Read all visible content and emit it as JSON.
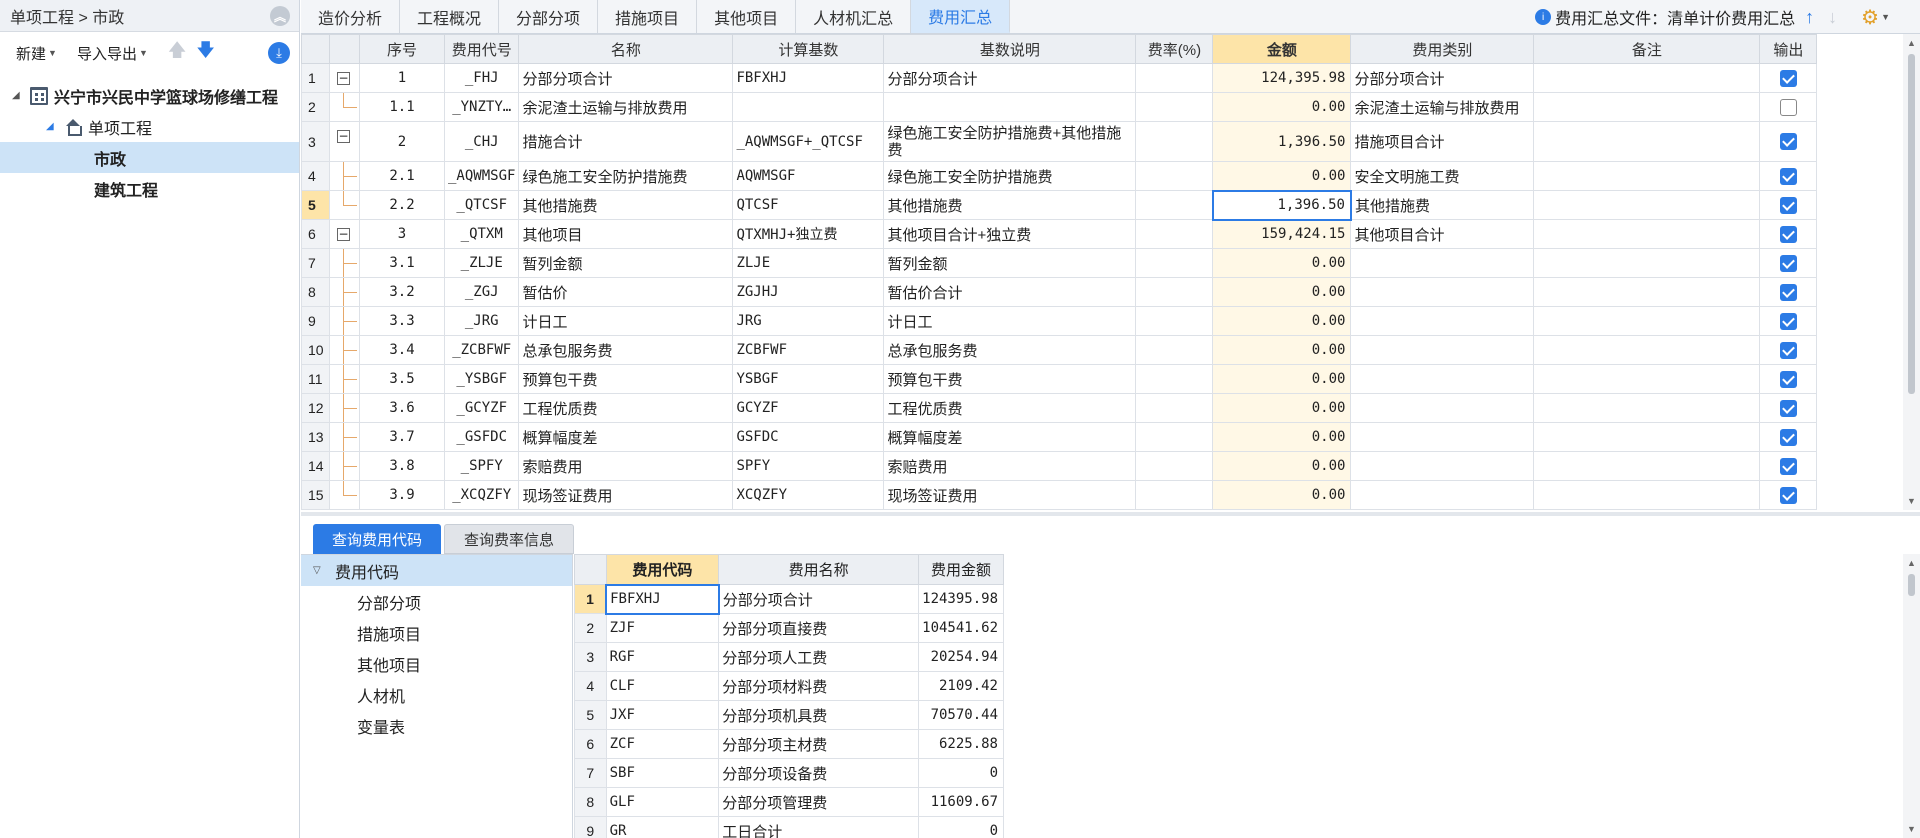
{
  "left": {
    "breadcrumb": "单项工程 > 市政",
    "toolbar": {
      "new_label": "新建",
      "import_export_label": "导入导出"
    },
    "tree": [
      {
        "label": "兴宁市兴民中学篮球场修缮工程",
        "icon": "building-icon"
      },
      {
        "label": "单项工程",
        "icon": "home-icon"
      },
      {
        "label": "市政",
        "selected": true
      },
      {
        "label": "建筑工程"
      }
    ]
  },
  "tabs": [
    {
      "label": "造价分析"
    },
    {
      "label": "工程概况"
    },
    {
      "label": "分部分项"
    },
    {
      "label": "措施项目"
    },
    {
      "label": "其他项目"
    },
    {
      "label": "人材机汇总"
    },
    {
      "label": "费用汇总",
      "active": true
    }
  ],
  "file_info": {
    "label": "费用汇总文件：清单计价费用汇总"
  },
  "main_table": {
    "headers": [
      "序号",
      "费用代号",
      "名称",
      "计算基数",
      "基数说明",
      "费率(%)",
      "金额",
      "费用类别",
      "备注",
      "输出"
    ],
    "rows": [
      {
        "num": "1",
        "seq": "1",
        "code": "_FHJ",
        "name": "分部分项合计",
        "base": "FBFXHJ",
        "desc": "分部分项合计",
        "rate": "",
        "amount": "124,395.98",
        "category": "分部分项合计",
        "note": "",
        "output": true,
        "level": 0
      },
      {
        "num": "2",
        "seq": "1.1",
        "code": "_YNZTY…",
        "name": "余泥渣土运输与排放费用",
        "base": "",
        "desc": "",
        "rate": "",
        "amount": "0.00",
        "category": "余泥渣土运输与排放费用",
        "note": "",
        "output": false,
        "level": 1
      },
      {
        "num": "3",
        "seq": "2",
        "code": "_CHJ",
        "name": "措施合计",
        "base": "_AQWMSGF+_QTCSF",
        "desc": "绿色施工安全防护措施费+其他措施费",
        "rate": "",
        "amount": "1,396.50",
        "category": "措施项目合计",
        "note": "",
        "output": true,
        "level": 0
      },
      {
        "num": "4",
        "seq": "2.1",
        "code": "_AQWMSGF",
        "name": "绿色施工安全防护措施费",
        "base": "AQWMSGF",
        "desc": "绿色施工安全防护措施费",
        "rate": "",
        "amount": "0.00",
        "category": "安全文明施工费",
        "note": "",
        "output": true,
        "level": 1
      },
      {
        "num": "5",
        "seq": "2.2",
        "code": "_QTCSF",
        "name": "其他措施费",
        "base": "QTCSF",
        "desc": "其他措施费",
        "rate": "",
        "amount": "1,396.50",
        "category": "其他措施费",
        "note": "",
        "output": true,
        "level": 1,
        "selected": true
      },
      {
        "num": "6",
        "seq": "3",
        "code": "_QTXM",
        "name": "其他项目",
        "base": "QTXMHJ+独立费",
        "desc": "其他项目合计+独立费",
        "rate": "",
        "amount": "159,424.15",
        "category": "其他项目合计",
        "note": "",
        "output": true,
        "level": 0
      },
      {
        "num": "7",
        "seq": "3.1",
        "code": "_ZLJE",
        "name": "暂列金额",
        "base": "ZLJE",
        "desc": "暂列金额",
        "rate": "",
        "amount": "0.00",
        "category": "",
        "note": "",
        "output": true,
        "level": 1
      },
      {
        "num": "8",
        "seq": "3.2",
        "code": "_ZGJ",
        "name": "暂估价",
        "base": "ZGJHJ",
        "desc": "暂估价合计",
        "rate": "",
        "amount": "0.00",
        "category": "",
        "note": "",
        "output": true,
        "level": 1
      },
      {
        "num": "9",
        "seq": "3.3",
        "code": "_JRG",
        "name": "计日工",
        "base": "JRG",
        "desc": "计日工",
        "rate": "",
        "amount": "0.00",
        "category": "",
        "note": "",
        "output": true,
        "level": 1
      },
      {
        "num": "10",
        "seq": "3.4",
        "code": "_ZCBFWF",
        "name": "总承包服务费",
        "base": "ZCBFWF",
        "desc": "总承包服务费",
        "rate": "",
        "amount": "0.00",
        "category": "",
        "note": "",
        "output": true,
        "level": 1
      },
      {
        "num": "11",
        "seq": "3.5",
        "code": "_YSBGF",
        "name": "预算包干费",
        "base": "YSBGF",
        "desc": "预算包干费",
        "rate": "",
        "amount": "0.00",
        "category": "",
        "note": "",
        "output": true,
        "level": 1
      },
      {
        "num": "12",
        "seq": "3.6",
        "code": "_GCYZF",
        "name": "工程优质费",
        "base": "GCYZF",
        "desc": "工程优质费",
        "rate": "",
        "amount": "0.00",
        "category": "",
        "note": "",
        "output": true,
        "level": 1
      },
      {
        "num": "13",
        "seq": "3.7",
        "code": "_GSFDC",
        "name": "概算幅度差",
        "base": "GSFDC",
        "desc": "概算幅度差",
        "rate": "",
        "amount": "0.00",
        "category": "",
        "note": "",
        "output": true,
        "level": 1
      },
      {
        "num": "14",
        "seq": "3.8",
        "code": "_SPFY",
        "name": "索赔费用",
        "base": "SPFY",
        "desc": "索赔费用",
        "rate": "",
        "amount": "0.00",
        "category": "",
        "note": "",
        "output": true,
        "level": 1
      },
      {
        "num": "15",
        "seq": "3.9",
        "code": "_XCQZFY",
        "name": "现场签证费用",
        "base": "XCQZFY",
        "desc": "现场签证费用",
        "rate": "",
        "amount": "0.00",
        "category": "",
        "note": "",
        "output": true,
        "level": 1
      }
    ]
  },
  "bottom": {
    "tabs": [
      {
        "label": "查询费用代码",
        "active": true
      },
      {
        "label": "查询费率信息"
      }
    ],
    "code_tree": {
      "root": "费用代码",
      "items": [
        "分部分项",
        "措施项目",
        "其他项目",
        "人材机",
        "变量表"
      ]
    },
    "code_table": {
      "headers": [
        "费用代码",
        "费用名称",
        "费用金额"
      ],
      "rows": [
        {
          "num": "1",
          "code": "FBFXHJ",
          "name": "分部分项合计",
          "amount": "124395.98",
          "selected": true
        },
        {
          "num": "2",
          "code": "ZJF",
          "name": "分部分项直接费",
          "amount": "104541.62"
        },
        {
          "num": "3",
          "code": "RGF",
          "name": "分部分项人工费",
          "amount": "20254.94"
        },
        {
          "num": "4",
          "code": "CLF",
          "name": "分部分项材料费",
          "amount": "2109.42"
        },
        {
          "num": "5",
          "code": "JXF",
          "name": "分部分项机具费",
          "amount": "70570.44"
        },
        {
          "num": "6",
          "code": "ZCF",
          "name": "分部分项主材费",
          "amount": "6225.88"
        },
        {
          "num": "7",
          "code": "SBF",
          "name": "分部分项设备费",
          "amount": "0"
        },
        {
          "num": "8",
          "code": "GLF",
          "name": "分部分项管理费",
          "amount": "11609.67"
        },
        {
          "num": "9",
          "code": "GR",
          "name": "工日合计",
          "amount": "0"
        }
      ]
    }
  },
  "colors": {
    "accent": "#2c7be5",
    "amount_header": "#fde4a8",
    "selection": "#cde3f7"
  }
}
